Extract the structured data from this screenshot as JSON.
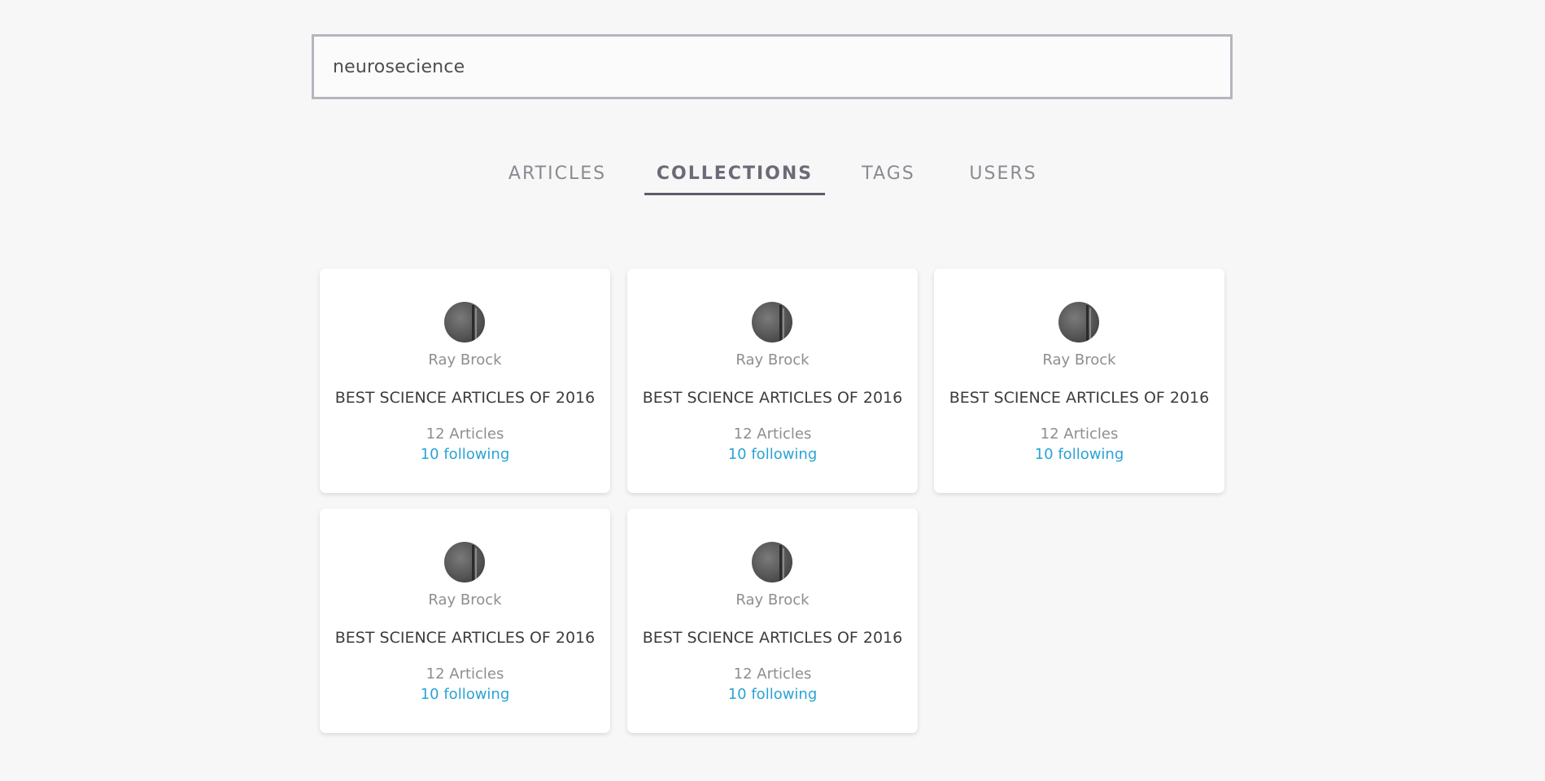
{
  "search": {
    "value": "neurosecience",
    "placeholder": ""
  },
  "tabs": [
    {
      "label": "ARTICLES",
      "active": false
    },
    {
      "label": "COLLECTIONS",
      "active": true
    },
    {
      "label": "TAGS",
      "active": false
    },
    {
      "label": "USERS",
      "active": false
    }
  ],
  "colors": {
    "link": "#2aa3d6",
    "active_tab_underline": "#5d5d6b",
    "background": "#f7f7f7"
  },
  "collections": [
    {
      "author": "Ray Brock",
      "title": "BEST SCIENCE ARTICLES OF 2016",
      "articles": "12 Articles",
      "following": "10 following"
    },
    {
      "author": "Ray Brock",
      "title": "BEST SCIENCE ARTICLES OF 2016",
      "articles": "12 Articles",
      "following": "10 following"
    },
    {
      "author": "Ray Brock",
      "title": "BEST SCIENCE ARTICLES OF 2016",
      "articles": "12 Articles",
      "following": "10 following"
    },
    {
      "author": "Ray Brock",
      "title": "BEST SCIENCE ARTICLES OF 2016",
      "articles": "12 Articles",
      "following": "10 following"
    },
    {
      "author": "Ray Brock",
      "title": "BEST SCIENCE ARTICLES OF 2016",
      "articles": "12 Articles",
      "following": "10 following"
    }
  ]
}
